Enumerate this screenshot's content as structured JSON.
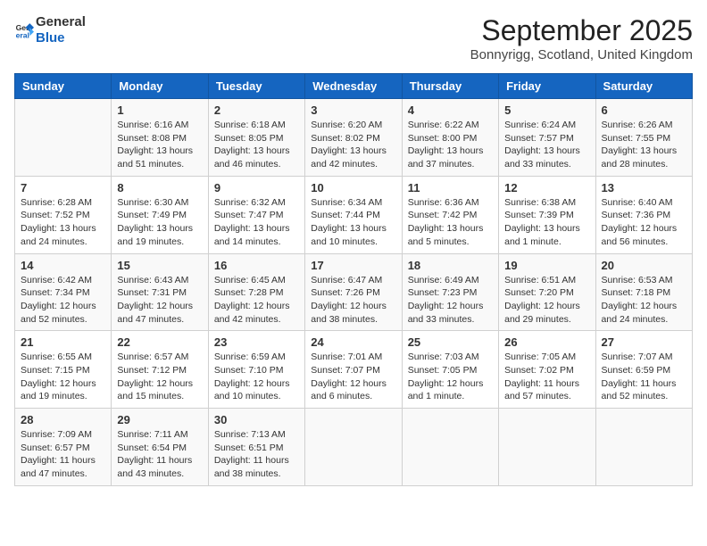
{
  "header": {
    "logo_general": "General",
    "logo_blue": "Blue",
    "month_title": "September 2025",
    "location": "Bonnyrigg, Scotland, United Kingdom"
  },
  "days_of_week": [
    "Sunday",
    "Monday",
    "Tuesday",
    "Wednesday",
    "Thursday",
    "Friday",
    "Saturday"
  ],
  "weeks": [
    [
      {
        "day": "",
        "detail": ""
      },
      {
        "day": "1",
        "detail": "Sunrise: 6:16 AM\nSunset: 8:08 PM\nDaylight: 13 hours and 51 minutes."
      },
      {
        "day": "2",
        "detail": "Sunrise: 6:18 AM\nSunset: 8:05 PM\nDaylight: 13 hours and 46 minutes."
      },
      {
        "day": "3",
        "detail": "Sunrise: 6:20 AM\nSunset: 8:02 PM\nDaylight: 13 hours and 42 minutes."
      },
      {
        "day": "4",
        "detail": "Sunrise: 6:22 AM\nSunset: 8:00 PM\nDaylight: 13 hours and 37 minutes."
      },
      {
        "day": "5",
        "detail": "Sunrise: 6:24 AM\nSunset: 7:57 PM\nDaylight: 13 hours and 33 minutes."
      },
      {
        "day": "6",
        "detail": "Sunrise: 6:26 AM\nSunset: 7:55 PM\nDaylight: 13 hours and 28 minutes."
      }
    ],
    [
      {
        "day": "7",
        "detail": "Sunrise: 6:28 AM\nSunset: 7:52 PM\nDaylight: 13 hours and 24 minutes."
      },
      {
        "day": "8",
        "detail": "Sunrise: 6:30 AM\nSunset: 7:49 PM\nDaylight: 13 hours and 19 minutes."
      },
      {
        "day": "9",
        "detail": "Sunrise: 6:32 AM\nSunset: 7:47 PM\nDaylight: 13 hours and 14 minutes."
      },
      {
        "day": "10",
        "detail": "Sunrise: 6:34 AM\nSunset: 7:44 PM\nDaylight: 13 hours and 10 minutes."
      },
      {
        "day": "11",
        "detail": "Sunrise: 6:36 AM\nSunset: 7:42 PM\nDaylight: 13 hours and 5 minutes."
      },
      {
        "day": "12",
        "detail": "Sunrise: 6:38 AM\nSunset: 7:39 PM\nDaylight: 13 hours and 1 minute."
      },
      {
        "day": "13",
        "detail": "Sunrise: 6:40 AM\nSunset: 7:36 PM\nDaylight: 12 hours and 56 minutes."
      }
    ],
    [
      {
        "day": "14",
        "detail": "Sunrise: 6:42 AM\nSunset: 7:34 PM\nDaylight: 12 hours and 52 minutes."
      },
      {
        "day": "15",
        "detail": "Sunrise: 6:43 AM\nSunset: 7:31 PM\nDaylight: 12 hours and 47 minutes."
      },
      {
        "day": "16",
        "detail": "Sunrise: 6:45 AM\nSunset: 7:28 PM\nDaylight: 12 hours and 42 minutes."
      },
      {
        "day": "17",
        "detail": "Sunrise: 6:47 AM\nSunset: 7:26 PM\nDaylight: 12 hours and 38 minutes."
      },
      {
        "day": "18",
        "detail": "Sunrise: 6:49 AM\nSunset: 7:23 PM\nDaylight: 12 hours and 33 minutes."
      },
      {
        "day": "19",
        "detail": "Sunrise: 6:51 AM\nSunset: 7:20 PM\nDaylight: 12 hours and 29 minutes."
      },
      {
        "day": "20",
        "detail": "Sunrise: 6:53 AM\nSunset: 7:18 PM\nDaylight: 12 hours and 24 minutes."
      }
    ],
    [
      {
        "day": "21",
        "detail": "Sunrise: 6:55 AM\nSunset: 7:15 PM\nDaylight: 12 hours and 19 minutes."
      },
      {
        "day": "22",
        "detail": "Sunrise: 6:57 AM\nSunset: 7:12 PM\nDaylight: 12 hours and 15 minutes."
      },
      {
        "day": "23",
        "detail": "Sunrise: 6:59 AM\nSunset: 7:10 PM\nDaylight: 12 hours and 10 minutes."
      },
      {
        "day": "24",
        "detail": "Sunrise: 7:01 AM\nSunset: 7:07 PM\nDaylight: 12 hours and 6 minutes."
      },
      {
        "day": "25",
        "detail": "Sunrise: 7:03 AM\nSunset: 7:05 PM\nDaylight: 12 hours and 1 minute."
      },
      {
        "day": "26",
        "detail": "Sunrise: 7:05 AM\nSunset: 7:02 PM\nDaylight: 11 hours and 57 minutes."
      },
      {
        "day": "27",
        "detail": "Sunrise: 7:07 AM\nSunset: 6:59 PM\nDaylight: 11 hours and 52 minutes."
      }
    ],
    [
      {
        "day": "28",
        "detail": "Sunrise: 7:09 AM\nSunset: 6:57 PM\nDaylight: 11 hours and 47 minutes."
      },
      {
        "day": "29",
        "detail": "Sunrise: 7:11 AM\nSunset: 6:54 PM\nDaylight: 11 hours and 43 minutes."
      },
      {
        "day": "30",
        "detail": "Sunrise: 7:13 AM\nSunset: 6:51 PM\nDaylight: 11 hours and 38 minutes."
      },
      {
        "day": "",
        "detail": ""
      },
      {
        "day": "",
        "detail": ""
      },
      {
        "day": "",
        "detail": ""
      },
      {
        "day": "",
        "detail": ""
      }
    ]
  ]
}
